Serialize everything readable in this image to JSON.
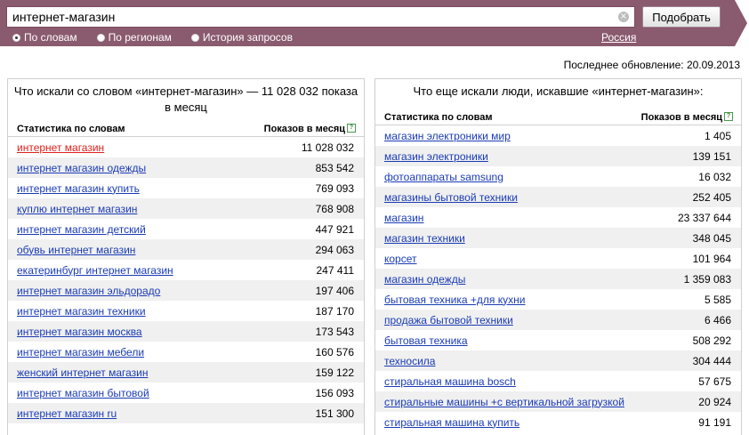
{
  "search": {
    "query": "интернет-магазин",
    "clear_glyph": "×",
    "submit_label": "Подобрать",
    "modes": [
      {
        "label": "По словам",
        "selected": true
      },
      {
        "label": "По регионам",
        "selected": false
      },
      {
        "label": "История запросов",
        "selected": false
      }
    ],
    "region": "Россия"
  },
  "last_update": "Последнее обновление: 20.09.2013",
  "colors": {
    "band": "#8a5a6e",
    "link": "#1a3bb5",
    "highlight": "#e0201a"
  },
  "left": {
    "title": "Что искали со словом «интернет-магазин» — 11 028 032 показа в месяц",
    "col_phrase": "Статистика по словам",
    "col_count": "Показов в месяц",
    "help_glyph": "?",
    "rows": [
      {
        "phrase": "интернет магазин",
        "count": "11 028 032"
      },
      {
        "phrase": "интернет магазин одежды",
        "count": "853 542"
      },
      {
        "phrase": "интернет магазин купить",
        "count": "769 093"
      },
      {
        "phrase": "куплю интернет магазин",
        "count": "768 908"
      },
      {
        "phrase": "интернет магазин детский",
        "count": "447 921"
      },
      {
        "phrase": "обувь интернет магазин",
        "count": "294 063"
      },
      {
        "phrase": "екатеринбург интернет магазин",
        "count": "247 411"
      },
      {
        "phrase": "интернет магазин эльдорадо",
        "count": "197 406"
      },
      {
        "phrase": "интернет магазин техники",
        "count": "187 170"
      },
      {
        "phrase": "интернет магазин москва",
        "count": "173 543"
      },
      {
        "phrase": "интернет магазин мебели",
        "count": "160 576"
      },
      {
        "phrase": "женский интернет магазин",
        "count": "159 122"
      },
      {
        "phrase": "интернет магазин бытовой",
        "count": "156 093"
      },
      {
        "phrase": "интернет магазин ru",
        "count": "151 300"
      }
    ]
  },
  "right": {
    "title": "Что еще искали люди, искавшие «интернет-магазин»:",
    "col_phrase": "Статистика по словам",
    "col_count": "Показов в месяц",
    "help_glyph": "?",
    "rows": [
      {
        "phrase": "магазин электроники мир",
        "count": "1 405"
      },
      {
        "phrase": "магазин электроники",
        "count": "139 151"
      },
      {
        "phrase": "фотоаппараты samsung",
        "count": "16 032"
      },
      {
        "phrase": "магазины бытовой техники",
        "count": "252 405"
      },
      {
        "phrase": "магазин",
        "count": "23 337 644"
      },
      {
        "phrase": "магазин техники",
        "count": "348 045"
      },
      {
        "phrase": "корсет",
        "count": "101 964"
      },
      {
        "phrase": "магазин одежды",
        "count": "1 359 083"
      },
      {
        "phrase": "бытовая техника +для кухни",
        "count": "5 585"
      },
      {
        "phrase": "продажа бытовой техники",
        "count": "6 466"
      },
      {
        "phrase": "бытовая техника",
        "count": "508 292"
      },
      {
        "phrase": "техносила",
        "count": "304 444"
      },
      {
        "phrase": "стиральная машина bosch",
        "count": "57 675"
      },
      {
        "phrase": "стиральные машины +с вертикальной загрузкой",
        "count": "20 924"
      },
      {
        "phrase": "стиральная машина купить",
        "count": "91 191"
      }
    ]
  }
}
